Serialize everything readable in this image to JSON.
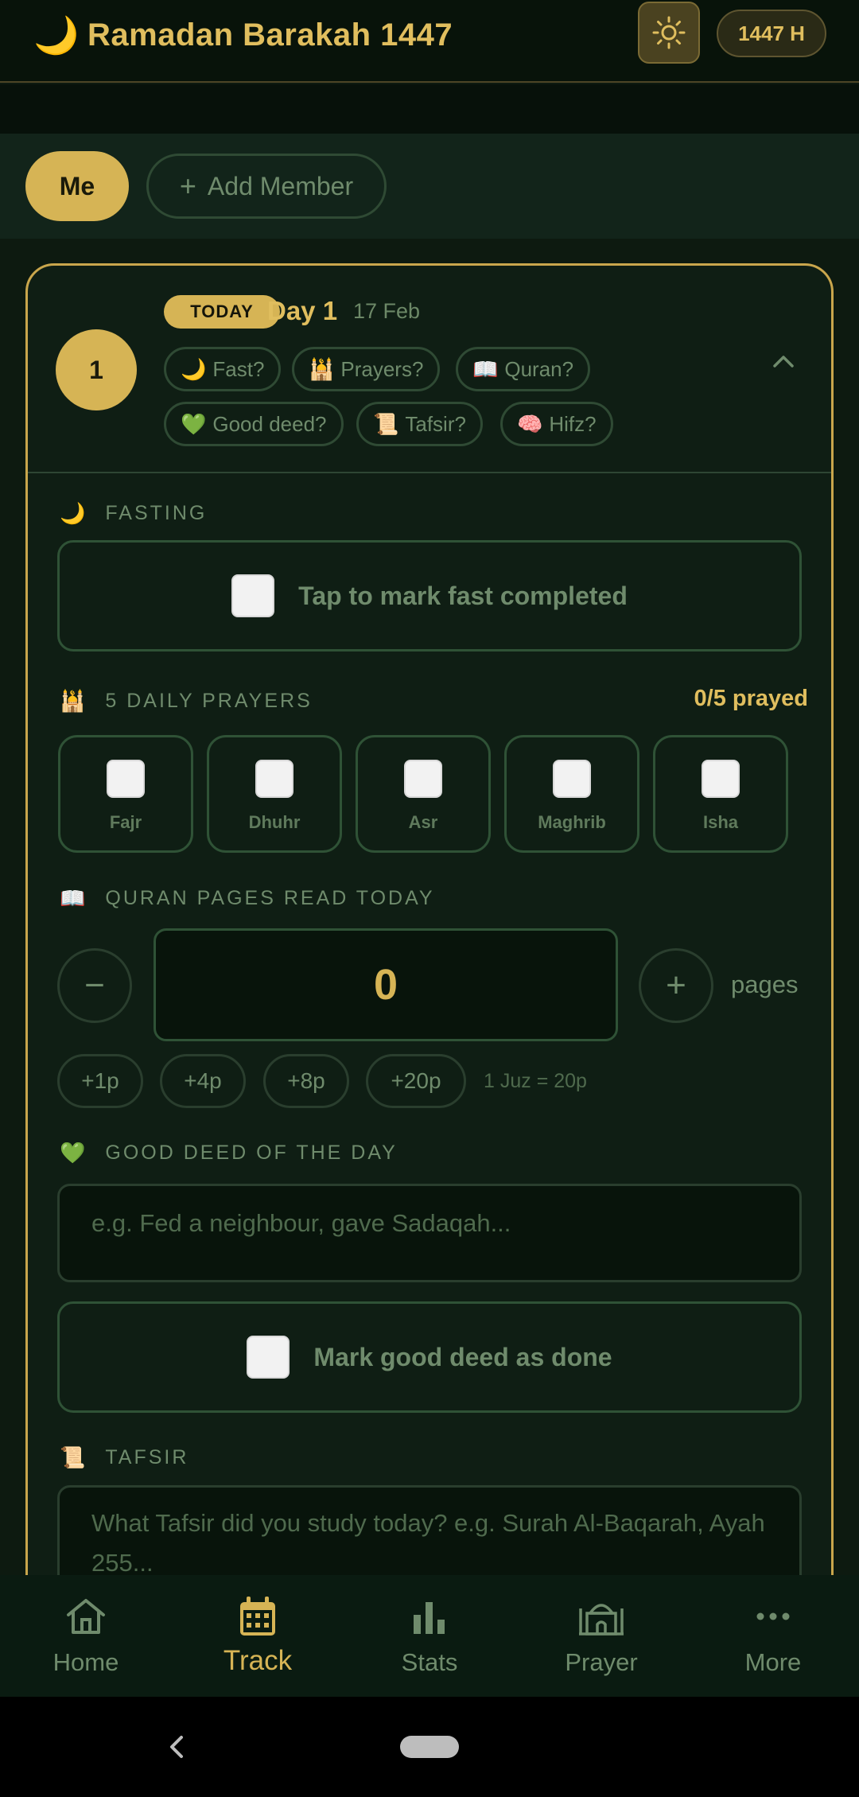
{
  "header": {
    "title": "Ramadan Barakah 1447",
    "hijri_badge": "1447 H",
    "moon_icon": "🌙"
  },
  "members": {
    "active": "Me",
    "add_label": "Add Member"
  },
  "day_card": {
    "number": "1",
    "today_badge": "TODAY",
    "day_label": "Day 1",
    "date": "17 Feb",
    "chips": [
      {
        "icon": "🌙",
        "label": "Fast?"
      },
      {
        "icon": "🕌",
        "label": "Prayers?"
      },
      {
        "icon": "📖",
        "label": "Quran?"
      },
      {
        "icon": "💚",
        "label": "Good deed?"
      },
      {
        "icon": "📜",
        "label": "Tafsir?"
      },
      {
        "icon": "🧠",
        "label": "Hifz?"
      }
    ]
  },
  "fasting": {
    "icon": "🌙",
    "title": "FASTING",
    "toggle_label": "Tap to mark fast completed"
  },
  "prayers": {
    "icon": "🕌",
    "title": "5 DAILY PRAYERS",
    "count": "0/5 prayed",
    "items": [
      "Fajr",
      "Dhuhr",
      "Asr",
      "Maghrib",
      "Isha"
    ]
  },
  "quran": {
    "icon": "📖",
    "title": "QURAN PAGES READ TODAY",
    "value": "0",
    "minus": "−",
    "plus": "+",
    "unit": "pages",
    "quick": [
      "+1p",
      "+4p",
      "+8p",
      "+20p"
    ],
    "note": "1 Juz = 20p"
  },
  "good_deed": {
    "icon": "💚",
    "title": "GOOD DEED OF THE DAY",
    "placeholder": "e.g. Fed a neighbour, gave Sadaqah...",
    "toggle_label": "Mark good deed as done"
  },
  "tafsir": {
    "icon": "📜",
    "title": "TAFSIR",
    "placeholder": "What Tafsir did you study today? e.g. Surah Al-Baqarah, Ayah 255..."
  },
  "nav": [
    {
      "label": "Home",
      "icon": "home-icon"
    },
    {
      "label": "Track",
      "icon": "calendar-icon"
    },
    {
      "label": "Stats",
      "icon": "bar-chart-icon"
    },
    {
      "label": "Prayer",
      "icon": "mosque-icon"
    },
    {
      "label": "More",
      "icon": "more-icon"
    }
  ],
  "colors": {
    "accent": "#d6b455",
    "background": "#0d1a10",
    "muted": "#6f8b6c"
  }
}
